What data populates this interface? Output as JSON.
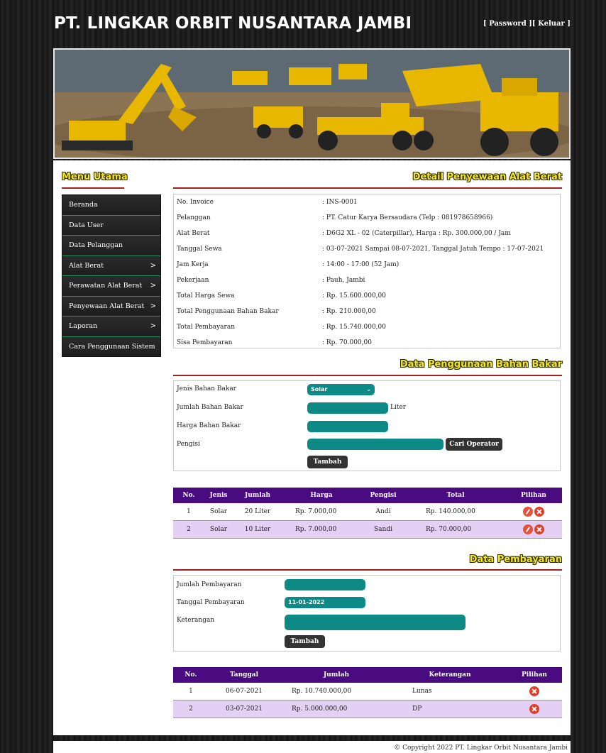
{
  "header": {
    "title": "PT. LINGKAR ORBIT NUSANTARA JAMBI",
    "link_password": "[ Password ]",
    "link_keluar": "[ Keluar ]"
  },
  "sidebar": {
    "title": "Menu Utama",
    "items": [
      {
        "label": "Beranda"
      },
      {
        "label": "Data User"
      },
      {
        "label": "Data Pelanggan"
      },
      {
        "label": "Alat Berat",
        "chevron": ">"
      },
      {
        "label": "Perawatan Alat Berat",
        "chevron": ">"
      },
      {
        "label": "Penyewaan Alat Berat",
        "chevron": ">"
      },
      {
        "label": "Laporan",
        "chevron": ">"
      },
      {
        "label": "Cara Penggunaan Sistem"
      }
    ]
  },
  "detail": {
    "title": "Detail Penyewaan Alat Berat",
    "rows": [
      {
        "label": "No. Invoice",
        "value": ": INS-0001"
      },
      {
        "label": "Pelanggan",
        "value": ": PT. Catur Karya Bersaudara (Telp : 081978658966)"
      },
      {
        "label": "Alat Berat",
        "value": ": D6G2 XL - 02 (Caterpillar), Harga : Rp. 300.000,00 / Jam"
      },
      {
        "label": "Tanggal Sewa",
        "value": ": 03-07-2021 Sampai 08-07-2021, Tanggal Jatuh Tempo : 17-07-2021"
      },
      {
        "label": "Jam Kerja",
        "value": ": 14:00 - 17:00 (52 Jam)"
      },
      {
        "label": "Pekerjaan",
        "value": ": Pauh, Jambi"
      },
      {
        "label": "Total Harga Sewa",
        "value": ": Rp. 15.600.000,00"
      },
      {
        "label": "Total Penggunaan Bahan Bakar",
        "value": ": Rp. 210.000,00"
      },
      {
        "label": "Total Pembayaran",
        "value": ": Rp. 15.740.000,00"
      },
      {
        "label": "Sisa Pembayaran",
        "value": ": Rp. 70.000,00"
      }
    ]
  },
  "fuel": {
    "title": "Data Penggunaan Bahan Bakar",
    "jenis_label": "Jenis Bahan Bakar",
    "jenis_value": "Solar",
    "jumlah_label": "Jumlah Bahan Bakar",
    "jumlah_unit": "Liter",
    "harga_label": "Harga Bahan Bakar",
    "pengisi_label": "Pengisi",
    "cari_button": "Cari Operator",
    "tambah_button": "Tambah",
    "table": {
      "headers": [
        "No.",
        "Jenis",
        "Jumlah",
        "Harga",
        "Pengisi",
        "Total",
        "Pilihan"
      ],
      "rows": [
        [
          "1",
          "Solar",
          "20 Liter",
          "Rp. 7.000,00",
          "Andi",
          "Rp. 140.000,00"
        ],
        [
          "2",
          "Solar",
          "10 Liter",
          "Rp. 7.000,00",
          "Sandi",
          "Rp. 70.000,00"
        ]
      ]
    }
  },
  "payment": {
    "title": "Data Pembayaran",
    "jumlah_label": "Jumlah Pembayaran",
    "tanggal_label": "Tanggal Pembayaran",
    "tanggal_value": "11-01-2022",
    "keterangan_label": "Keterangan",
    "tambah_button": "Tambah",
    "table": {
      "headers": [
        "No.",
        "Tanggal",
        "Jumlah",
        "Keterangan",
        "Pilihan"
      ],
      "rows": [
        [
          "1",
          "06-07-2021",
          "Rp. 10.740.000,00",
          "Lunas"
        ],
        [
          "2",
          "03-07-2021",
          "Rp. 5.000.000,00",
          "DP"
        ]
      ]
    }
  },
  "footer": {
    "text": "© Copyright 2022 PT. Lingkar Orbit Nusantara Jambi"
  },
  "colors": {
    "accent_yellow": "#f5e623",
    "input_teal": "#0d8a86",
    "table_header_purple": "#4a0b80",
    "row_alt": "#e4cff5",
    "divider_red": "#a42020"
  }
}
